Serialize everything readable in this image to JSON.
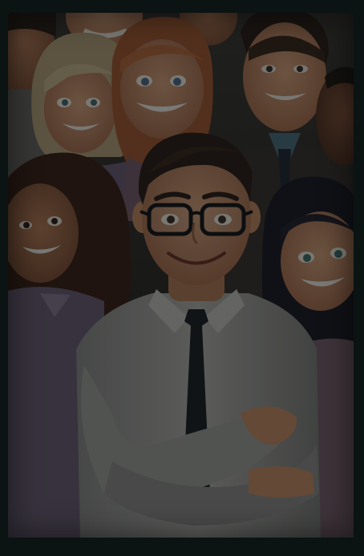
{
  "theme": {
    "backdrop": "#0b1313",
    "overlay": "#081010",
    "skin_light": "#c98f6a",
    "skin_tan": "#a86848",
    "skin_dark": "#6b3d28",
    "shirt_white": "#9a9794",
    "tie": "#1b1d22",
    "hair_dark": "#2a1a14",
    "hair_blonde": "#b8a07a",
    "hair_red": "#a5562e",
    "purple_top": "#6c5b72",
    "teal_top": "#3a5a64",
    "suit_brown": "#3a2f2a"
  },
  "image": {
    "subject_icons": [
      "group-of-people-illustration",
      "smiling-man-glasses-icon"
    ]
  }
}
